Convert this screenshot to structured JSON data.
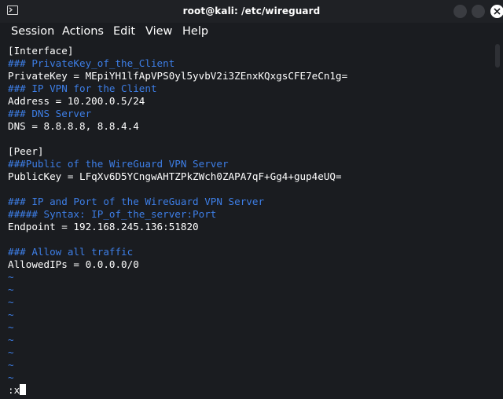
{
  "window": {
    "title": "root@kali: /etc/wireguard",
    "icons": [
      "terminal-icon",
      "minimize-icon",
      "maximize-icon",
      "close-icon"
    ]
  },
  "menu": {
    "session": "Session",
    "actions": "Actions",
    "edit": "Edit",
    "view": "View",
    "help": "Help"
  },
  "editor": {
    "lines": [
      {
        "text": "[Interface]",
        "kind": "normal"
      },
      {
        "text": "### PrivateKey_of_the_Client",
        "kind": "comment"
      },
      {
        "text": "PrivateKey = MEpiYH1lfApVPS0yl5yvbV2i3ZEnxKQxgsCFE7eCn1g=",
        "kind": "normal"
      },
      {
        "text": "### IP VPN for the Client",
        "kind": "comment"
      },
      {
        "text": "Address = 10.200.0.5/24",
        "kind": "normal"
      },
      {
        "text": "### DNS Server",
        "kind": "comment"
      },
      {
        "text": "DNS = 8.8.8.8, 8.8.4.4",
        "kind": "normal"
      },
      {
        "text": "",
        "kind": "normal"
      },
      {
        "text": "[Peer]",
        "kind": "normal"
      },
      {
        "text": "###Public of the WireGuard VPN Server",
        "kind": "comment"
      },
      {
        "text": "PublicKey = LFqXv6D5YCngwAHTZPkZWch0ZAPA7qF+Gg4+gup4eUQ=",
        "kind": "normal"
      },
      {
        "text": "",
        "kind": "normal"
      },
      {
        "text": "### IP and Port of the WireGuard VPN Server",
        "kind": "comment"
      },
      {
        "text": "##### Syntax: IP_of_the_server:Port",
        "kind": "comment"
      },
      {
        "text": "Endpoint = 192.168.245.136:51820",
        "kind": "normal"
      },
      {
        "text": "",
        "kind": "normal"
      },
      {
        "text": "### Allow all traffic",
        "kind": "comment"
      },
      {
        "text": "AllowedIPs = 0.0.0.0/0",
        "kind": "normal"
      },
      {
        "text": "~",
        "kind": "tilde"
      },
      {
        "text": "~",
        "kind": "tilde"
      },
      {
        "text": "~",
        "kind": "tilde"
      },
      {
        "text": "~",
        "kind": "tilde"
      },
      {
        "text": "~",
        "kind": "tilde"
      },
      {
        "text": "~",
        "kind": "tilde"
      },
      {
        "text": "~",
        "kind": "tilde"
      },
      {
        "text": "~",
        "kind": "tilde"
      },
      {
        "text": "~",
        "kind": "tilde"
      }
    ],
    "command_line": ":x"
  },
  "colors": {
    "background": "#1a1c20",
    "comment": "#3d7ee6",
    "text": "#ffffff"
  }
}
